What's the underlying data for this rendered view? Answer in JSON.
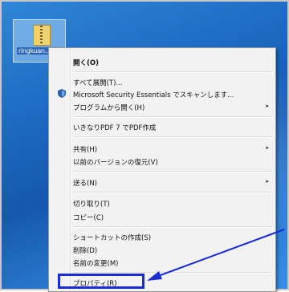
{
  "desktop": {
    "file_label": "ringkuan..hqu..obu"
  },
  "context_menu": {
    "items": [
      {
        "label": "開く(O)"
      },
      {
        "label": "すべて展開(T)..."
      },
      {
        "label": "Microsoft Security Essentials でスキャンします..."
      },
      {
        "label": "プログラムから開く(H)"
      },
      {
        "label": "いきなりPDF 7 でPDF作成"
      },
      {
        "label": "共有(H)"
      },
      {
        "label": "以前のバージョンの復元(V)"
      },
      {
        "label": "送る(N)"
      },
      {
        "label": "切り取り(T)"
      },
      {
        "label": "コピー(C)"
      },
      {
        "label": "ショートカットの作成(S)"
      },
      {
        "label": "削除(D)"
      },
      {
        "label": "名前の変更(M)"
      },
      {
        "label": "プロパティ(R)"
      }
    ],
    "submenu_arrow": "▸"
  },
  "annotation": {
    "highlight_color": "#1a2bd8"
  }
}
